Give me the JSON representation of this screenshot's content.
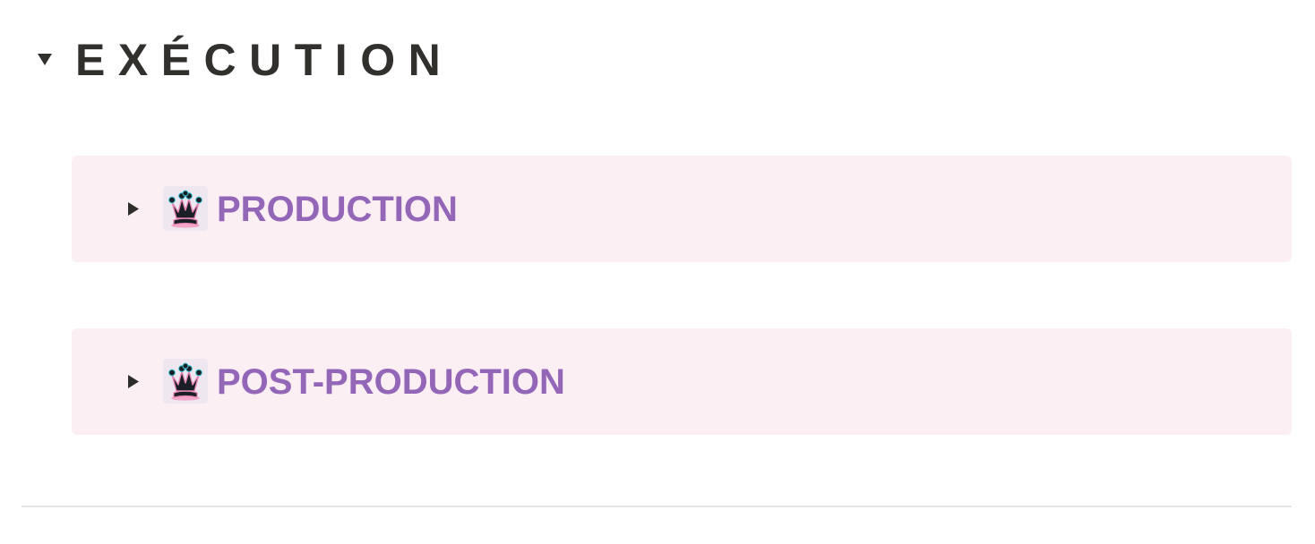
{
  "section": {
    "title": "EXÉCUTION",
    "expanded": true,
    "toggle_icon": "triangle-down-icon",
    "text_color": "#32302c"
  },
  "callouts": [
    {
      "title": "PRODUCTION",
      "icon": "crown-icon",
      "toggle_icon": "triangle-right-icon",
      "expanded": false
    },
    {
      "title": "POST-PRODUCTION",
      "icon": "crown-icon",
      "toggle_icon": "triangle-right-icon",
      "expanded": false
    }
  ],
  "colors": {
    "callout_background": "#fbeff4",
    "callout_title": "#9466b8",
    "divider": "#e6e4e4",
    "background": "#ffffff"
  }
}
